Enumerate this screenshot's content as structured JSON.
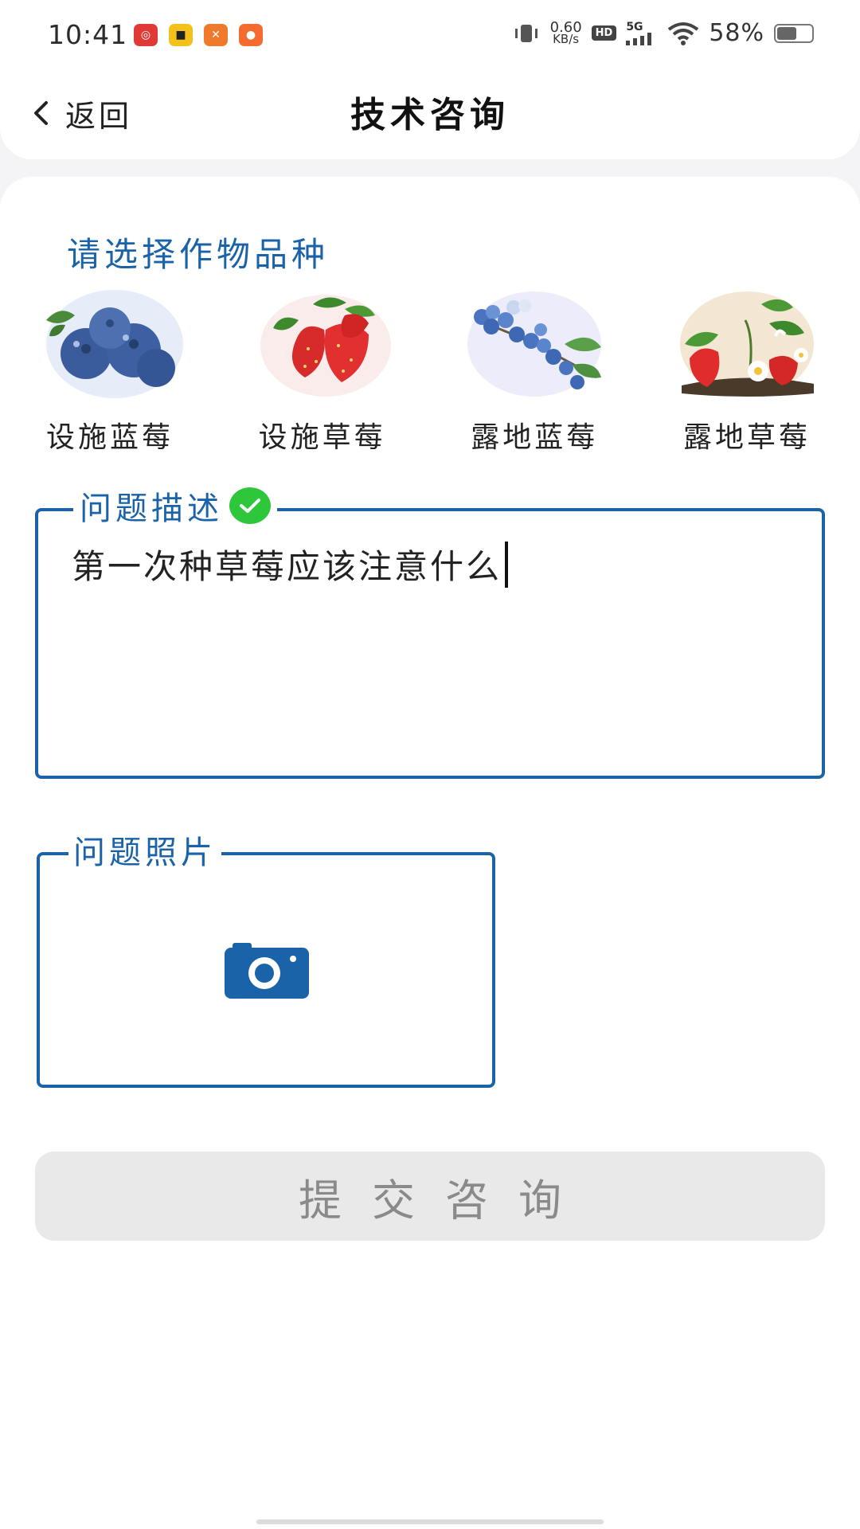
{
  "status_bar": {
    "time": "10:41",
    "app_icons": [
      {
        "name": "netease-music-icon",
        "color": "#e03a36",
        "glyph": "◎"
      },
      {
        "name": "taxi-app-icon",
        "color": "#f2c21a",
        "glyph": "■"
      },
      {
        "name": "orange-app-icon",
        "color": "#f07a2c",
        "glyph": "✕"
      },
      {
        "name": "game-app-icon",
        "color": "#f46b30",
        "glyph": "●"
      }
    ],
    "net_speed_value": "0.60",
    "net_speed_unit": "KB/s",
    "hd_label": "HD",
    "signal_label": "5G",
    "battery_percent": "58%",
    "battery_level": 0.58
  },
  "header": {
    "back_label": "返回",
    "title": "技术咨询"
  },
  "crop_section": {
    "title": "请选择作物品种",
    "crops": [
      {
        "label": "设施蓝莓",
        "kind": "blueberry-cluster"
      },
      {
        "label": "设施草莓",
        "kind": "strawberry-cluster"
      },
      {
        "label": "露地蓝莓",
        "kind": "blueberry-branch"
      },
      {
        "label": "露地草莓",
        "kind": "strawberry-plant"
      }
    ]
  },
  "description": {
    "legend": "问题描述",
    "value": "第一次种草莓应该注意什么"
  },
  "photo": {
    "legend": "问题照片"
  },
  "submit": {
    "label": "提交咨询"
  },
  "colors": {
    "accent": "#1b63a8",
    "check": "#2ec73c",
    "submit_bg": "#e9e9e9"
  }
}
